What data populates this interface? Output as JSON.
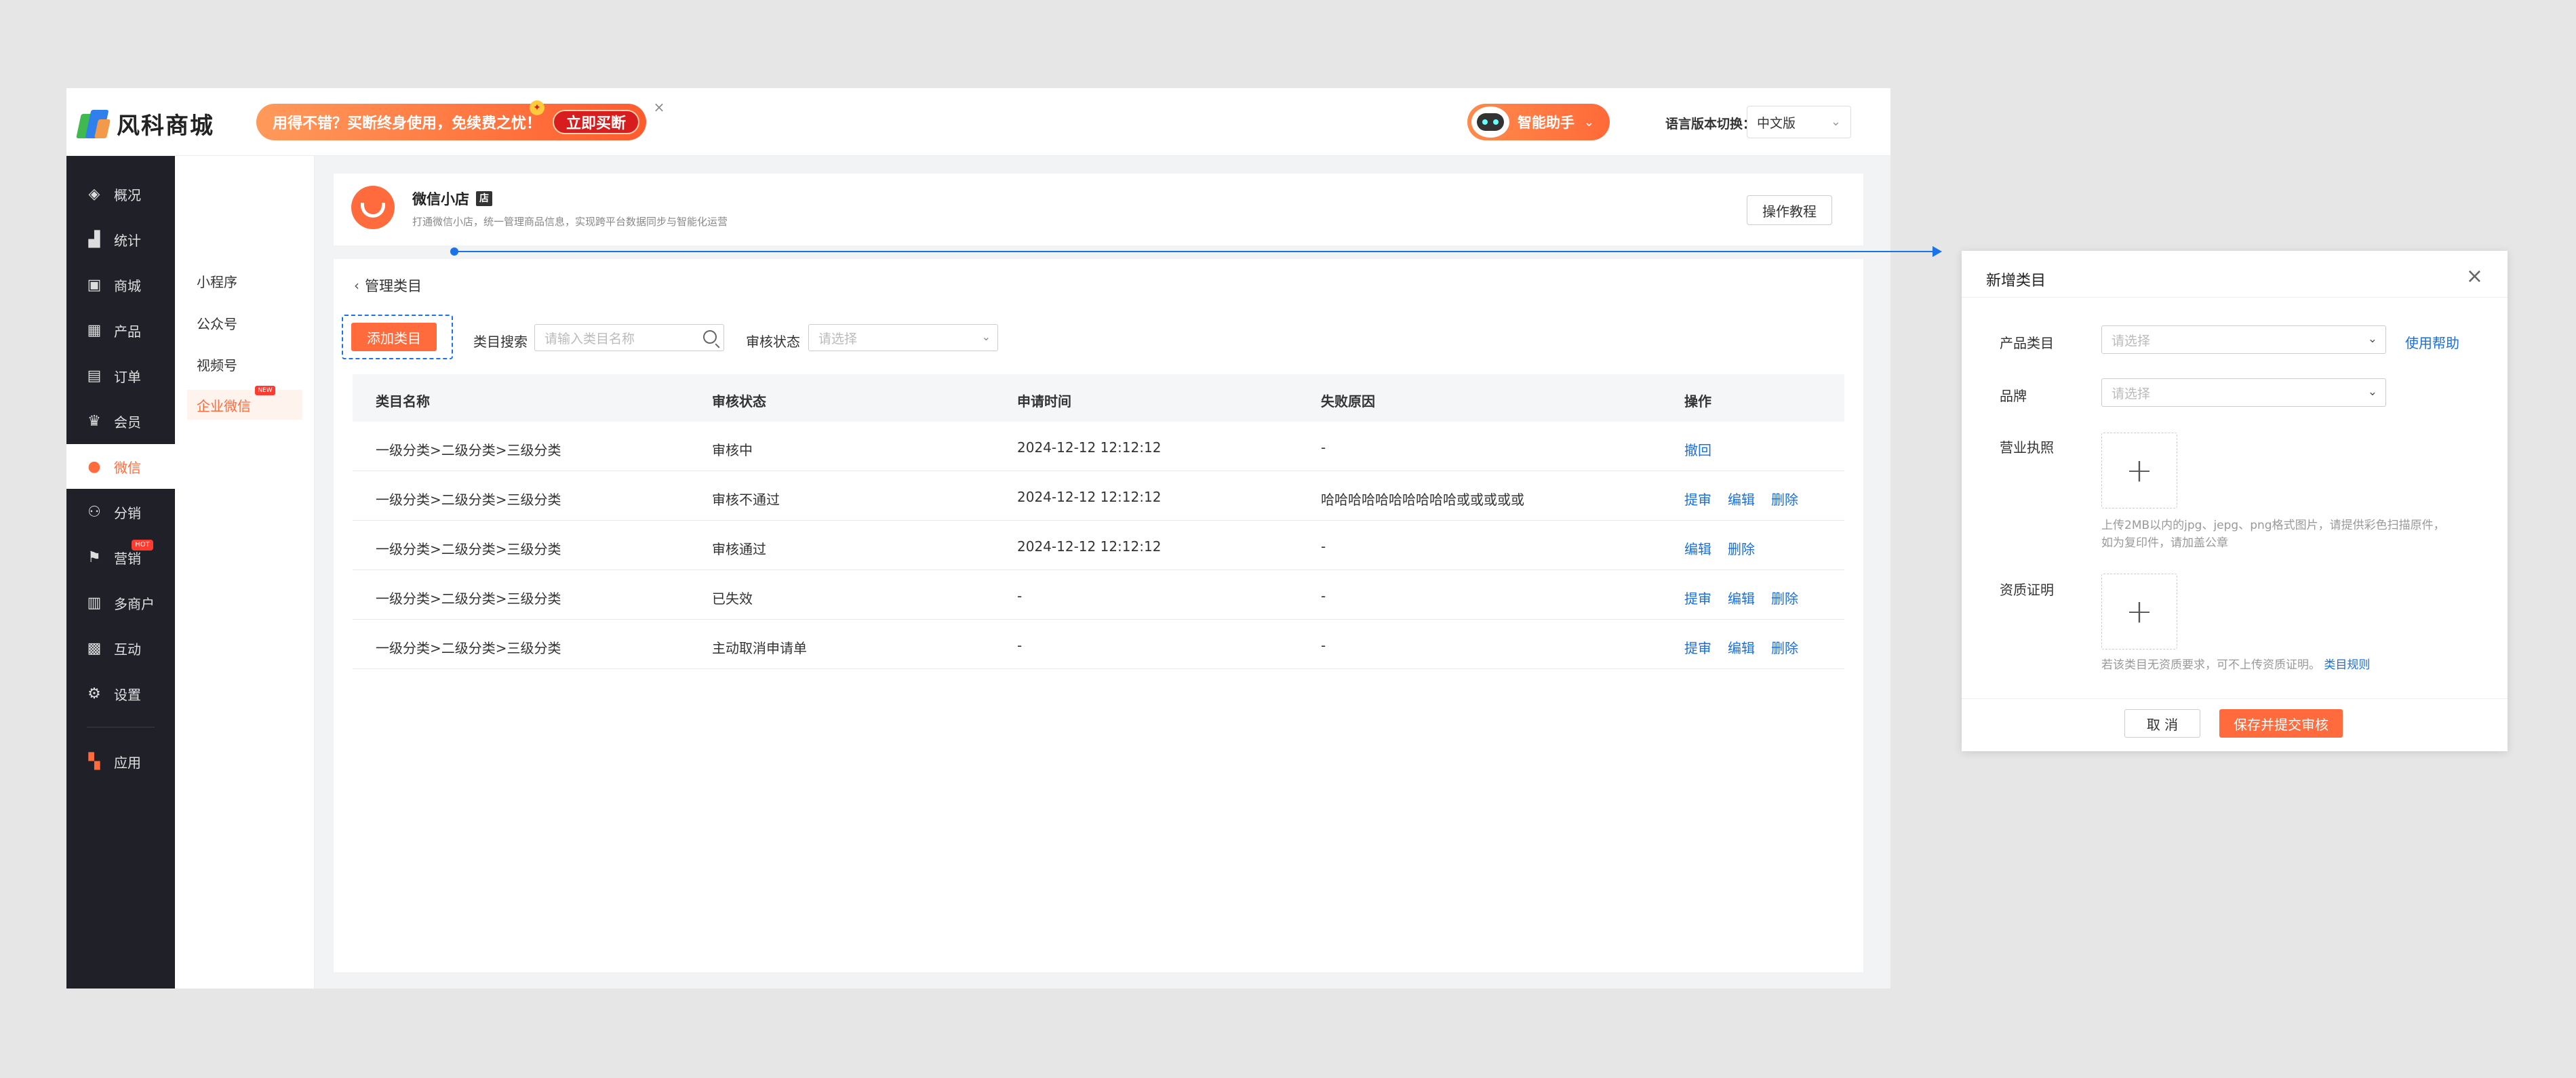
{
  "logo": {
    "text": "风科商城"
  },
  "promo": {
    "text": "用得不错？买断终身使用，免续费之忧！",
    "button": "立即买断",
    "close": "×"
  },
  "assistant": {
    "label": "智能助手"
  },
  "language": {
    "label": "语言版本切换：",
    "value": "中文版"
  },
  "sidebar": {
    "items": [
      {
        "label": "概况",
        "icon": "layers-icon"
      },
      {
        "label": "统计",
        "icon": "chart-icon"
      },
      {
        "label": "商城",
        "icon": "store-icon"
      },
      {
        "label": "产品",
        "icon": "grid-icon"
      },
      {
        "label": "订单",
        "icon": "order-icon"
      },
      {
        "label": "会员",
        "icon": "crown-icon"
      },
      {
        "label": "微信",
        "icon": "wechat-icon"
      },
      {
        "label": "分销",
        "icon": "distribution-icon"
      },
      {
        "label": "营销",
        "icon": "flag-icon"
      },
      {
        "label": "多商户",
        "icon": "multi-store-icon"
      },
      {
        "label": "互动",
        "icon": "interaction-icon"
      },
      {
        "label": "设置",
        "icon": "gear-icon"
      },
      {
        "label": "应用",
        "icon": "apps-icon"
      }
    ],
    "hot_badge": "HOT"
  },
  "subnav": {
    "items": [
      "小程序",
      "公众号",
      "视频号",
      "企业微信"
    ],
    "new_badge": "NEW"
  },
  "shop": {
    "name": "微信小店",
    "tag": "店",
    "desc": "打通微信小店，统一管理商品信息，实现跨平台数据同步与智能化运营",
    "tutorial_button": "操作教程"
  },
  "manage": {
    "title": "管理类目",
    "add_button": "添加类目",
    "search_label": "类目搜索",
    "search_placeholder": "请输入类目名称",
    "status_label": "审核状态",
    "status_placeholder": "请选择"
  },
  "table": {
    "headers": [
      "类目名称",
      "审核状态",
      "申请时间",
      "失败原因",
      "操作"
    ],
    "rows": [
      {
        "name": "一级分类>二级分类>三级分类",
        "status": "审核中",
        "time": "2024-12-12 12:12:12",
        "reason": "-",
        "ops": [
          "撤回"
        ]
      },
      {
        "name": "一级分类>二级分类>三级分类",
        "status": "审核不通过",
        "time": "2024-12-12 12:12:12",
        "reason": "哈哈哈哈哈哈哈哈哈哈或或或或或",
        "ops": [
          "提审",
          "编辑",
          "删除"
        ]
      },
      {
        "name": "一级分类>二级分类>三级分类",
        "status": "审核通过",
        "time": "2024-12-12 12:12:12",
        "reason": "-",
        "ops": [
          "编辑",
          "删除"
        ]
      },
      {
        "name": "一级分类>二级分类>三级分类",
        "status": "已失效",
        "time": "-",
        "reason": "-",
        "ops": [
          "提审",
          "编辑",
          "删除"
        ]
      },
      {
        "name": "一级分类>二级分类>三级分类",
        "status": "主动取消申请单",
        "time": "-",
        "reason": "-",
        "ops": [
          "提审",
          "编辑",
          "删除"
        ]
      }
    ]
  },
  "modal": {
    "title": "新增类目",
    "product_category_label": "产品类目",
    "product_category_placeholder": "请选择",
    "help_link": "使用帮助",
    "brand_label": "品牌",
    "brand_placeholder": "请选择",
    "license_label": "营业执照",
    "license_hint_1": "上传2MB以内的jpg、jepg、png格式图片，请提供彩色扫描原件，",
    "license_hint_2": "如为复印件，请加盖公章",
    "qualification_label": "资质证明",
    "qualification_hint": "若该类目无资质要求，可不上传资质证明。",
    "qualification_link": "类目规则",
    "cancel_button": "取 消",
    "submit_button": "保存并提交审核"
  }
}
